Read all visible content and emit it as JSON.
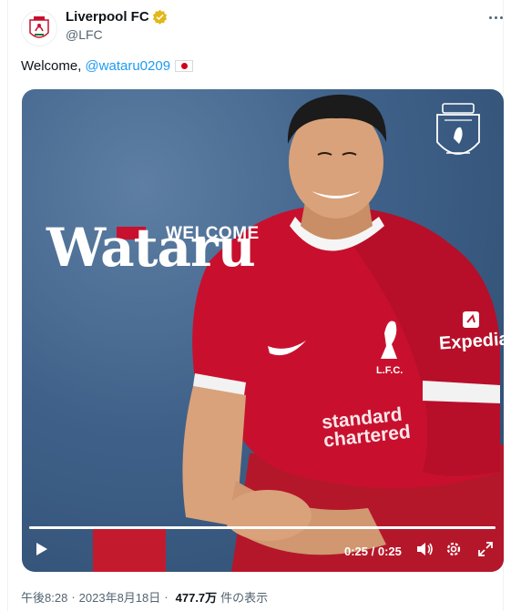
{
  "author": {
    "name": "Liverpool FC",
    "handle": "@LFC",
    "verified_icon": "verified-gold-badge",
    "avatar_icon": "lfc-crest"
  },
  "tweet": {
    "text": "Welcome,",
    "mention": "@wataru0209",
    "flag_icon": "japan-flag"
  },
  "media": {
    "welcome_label": "WELCOME",
    "name_label": "Wataru",
    "sponsor_text": "standard chartered",
    "sleeve_sponsor": "Expedia",
    "club_label": "L.F.C.",
    "progress": 1.0,
    "time": "0:25 / 0:25"
  },
  "meta": {
    "time": "午後8:28",
    "date": "2023年8月18日",
    "views": "477.7万",
    "views_suffix": "件の表示"
  },
  "colors": {
    "accent": "#1d9bf0",
    "lfc_red": "#c8102e",
    "verified_gold": "#e2b719"
  }
}
